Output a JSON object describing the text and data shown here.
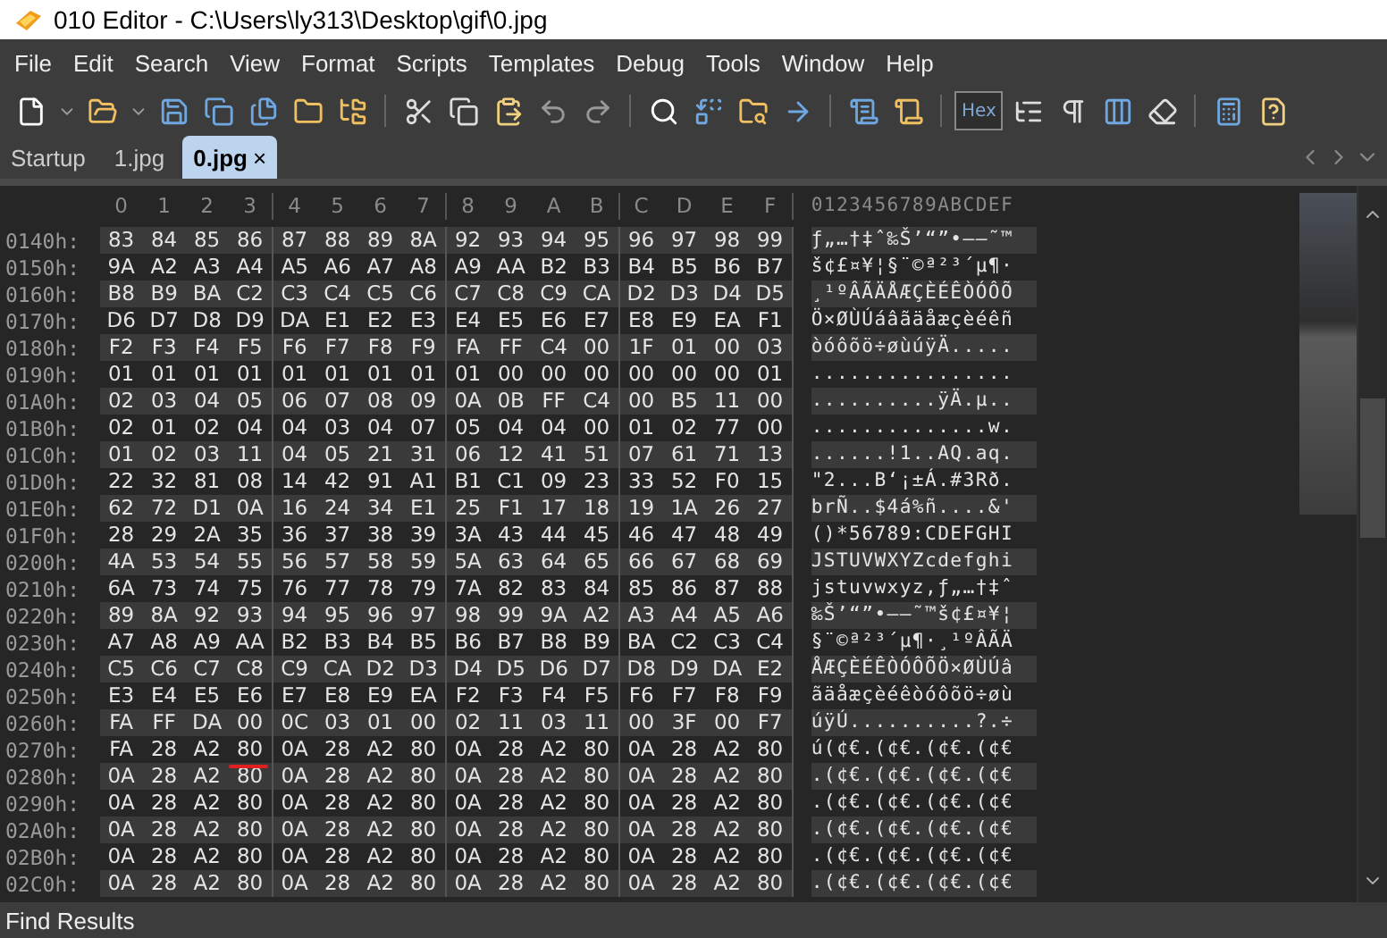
{
  "window": {
    "title": "010 Editor - C:\\Users\\ly313\\Desktop\\gif\\0.jpg"
  },
  "menu": [
    "File",
    "Edit",
    "Search",
    "View",
    "Format",
    "Scripts",
    "Templates",
    "Debug",
    "Tools",
    "Window",
    "Help"
  ],
  "toolbar": {
    "hex_toggle": {
      "label": "Hex",
      "selected": true
    }
  },
  "tabs": [
    {
      "label": "Startup",
      "selected": false
    },
    {
      "label": "1.jpg",
      "selected": false
    },
    {
      "label": "0.jpg",
      "selected": true,
      "close": "×"
    }
  ],
  "editor": {
    "columns": [
      "0",
      "1",
      "2",
      "3",
      "4",
      "5",
      "6",
      "7",
      "8",
      "9",
      "A",
      "B",
      "C",
      "D",
      "E",
      "F"
    ],
    "text_header": "0123456789ABCDEF",
    "rows": [
      {
        "address": "0140h:",
        "bytes": [
          "83",
          "84",
          "85",
          "86",
          "87",
          "88",
          "89",
          "8A",
          "92",
          "93",
          "94",
          "95",
          "96",
          "97",
          "98",
          "99"
        ],
        "text": "ƒ„…†‡ˆ‰Š’“”•–—˜™"
      },
      {
        "address": "0150h:",
        "bytes": [
          "9A",
          "A2",
          "A3",
          "A4",
          "A5",
          "A6",
          "A7",
          "A8",
          "A9",
          "AA",
          "B2",
          "B3",
          "B4",
          "B5",
          "B6",
          "B7"
        ],
        "text": "š¢£¤¥¦§¨©ª²³´µ¶·"
      },
      {
        "address": "0160h:",
        "bytes": [
          "B8",
          "B9",
          "BA",
          "C2",
          "C3",
          "C4",
          "C5",
          "C6",
          "C7",
          "C8",
          "C9",
          "CA",
          "D2",
          "D3",
          "D4",
          "D5"
        ],
        "text": "¸¹ºÂÃÄÅÆÇÈÉÊÒÓÔÕ"
      },
      {
        "address": "0170h:",
        "bytes": [
          "D6",
          "D7",
          "D8",
          "D9",
          "DA",
          "E1",
          "E2",
          "E3",
          "E4",
          "E5",
          "E6",
          "E7",
          "E8",
          "E9",
          "EA",
          "F1"
        ],
        "text": "Ö×ØÙÚáâãäåæçèéêñ"
      },
      {
        "address": "0180h:",
        "bytes": [
          "F2",
          "F3",
          "F4",
          "F5",
          "F6",
          "F7",
          "F8",
          "F9",
          "FA",
          "FF",
          "C4",
          "00",
          "1F",
          "01",
          "00",
          "03"
        ],
        "text": "òóôõö÷øùúÿÄ....."
      },
      {
        "address": "0190h:",
        "bytes": [
          "01",
          "01",
          "01",
          "01",
          "01",
          "01",
          "01",
          "01",
          "01",
          "00",
          "00",
          "00",
          "00",
          "00",
          "00",
          "01"
        ],
        "text": "................"
      },
      {
        "address": "01A0h:",
        "bytes": [
          "02",
          "03",
          "04",
          "05",
          "06",
          "07",
          "08",
          "09",
          "0A",
          "0B",
          "FF",
          "C4",
          "00",
          "B5",
          "11",
          "00"
        ],
        "text": "..........ÿÄ.µ.."
      },
      {
        "address": "01B0h:",
        "bytes": [
          "02",
          "01",
          "02",
          "04",
          "04",
          "03",
          "04",
          "07",
          "05",
          "04",
          "04",
          "00",
          "01",
          "02",
          "77",
          "00"
        ],
        "text": "..............w."
      },
      {
        "address": "01C0h:",
        "bytes": [
          "01",
          "02",
          "03",
          "11",
          "04",
          "05",
          "21",
          "31",
          "06",
          "12",
          "41",
          "51",
          "07",
          "61",
          "71",
          "13"
        ],
        "text": "......!1..AQ.aq."
      },
      {
        "address": "01D0h:",
        "bytes": [
          "22",
          "32",
          "81",
          "08",
          "14",
          "42",
          "91",
          "A1",
          "B1",
          "C1",
          "09",
          "23",
          "33",
          "52",
          "F0",
          "15"
        ],
        "text": "\"2...B‘¡±Á.#3Rð."
      },
      {
        "address": "01E0h:",
        "bytes": [
          "62",
          "72",
          "D1",
          "0A",
          "16",
          "24",
          "34",
          "E1",
          "25",
          "F1",
          "17",
          "18",
          "19",
          "1A",
          "26",
          "27"
        ],
        "text": "brÑ..$4á%ñ....&'"
      },
      {
        "address": "01F0h:",
        "bytes": [
          "28",
          "29",
          "2A",
          "35",
          "36",
          "37",
          "38",
          "39",
          "3A",
          "43",
          "44",
          "45",
          "46",
          "47",
          "48",
          "49"
        ],
        "text": "()*56789:CDEFGHI"
      },
      {
        "address": "0200h:",
        "bytes": [
          "4A",
          "53",
          "54",
          "55",
          "56",
          "57",
          "58",
          "59",
          "5A",
          "63",
          "64",
          "65",
          "66",
          "67",
          "68",
          "69"
        ],
        "text": "JSTUVWXYZcdefghi"
      },
      {
        "address": "0210h:",
        "bytes": [
          "6A",
          "73",
          "74",
          "75",
          "76",
          "77",
          "78",
          "79",
          "7A",
          "82",
          "83",
          "84",
          "85",
          "86",
          "87",
          "88"
        ],
        "text": "jstuvwxyz‚ƒ„…†‡ˆ"
      },
      {
        "address": "0220h:",
        "bytes": [
          "89",
          "8A",
          "92",
          "93",
          "94",
          "95",
          "96",
          "97",
          "98",
          "99",
          "9A",
          "A2",
          "A3",
          "A4",
          "A5",
          "A6"
        ],
        "text": "‰Š’“”•–—˜™š¢£¤¥¦"
      },
      {
        "address": "0230h:",
        "bytes": [
          "A7",
          "A8",
          "A9",
          "AA",
          "B2",
          "B3",
          "B4",
          "B5",
          "B6",
          "B7",
          "B8",
          "B9",
          "BA",
          "C2",
          "C3",
          "C4"
        ],
        "text": "§¨©ª²³´µ¶·¸¹ºÂÃÄ"
      },
      {
        "address": "0240h:",
        "bytes": [
          "C5",
          "C6",
          "C7",
          "C8",
          "C9",
          "CA",
          "D2",
          "D3",
          "D4",
          "D5",
          "D6",
          "D7",
          "D8",
          "D9",
          "DA",
          "E2"
        ],
        "text": "ÅÆÇÈÉÊÒÓÔÕÖ×ØÙÚâ"
      },
      {
        "address": "0250h:",
        "bytes": [
          "E3",
          "E4",
          "E5",
          "E6",
          "E7",
          "E8",
          "E9",
          "EA",
          "F2",
          "F3",
          "F4",
          "F5",
          "F6",
          "F7",
          "F8",
          "F9"
        ],
        "text": "ãäåæçèéêòóôõö÷øù"
      },
      {
        "address": "0260h:",
        "bytes": [
          "FA",
          "FF",
          "DA",
          "00",
          "0C",
          "03",
          "01",
          "00",
          "02",
          "11",
          "03",
          "11",
          "00",
          "3F",
          "00",
          "F7"
        ],
        "text": "úÿÚ..........?.÷"
      },
      {
        "address": "0270h:",
        "bytes": [
          "FA",
          "28",
          "A2",
          "80",
          "0A",
          "28",
          "A2",
          "80",
          "0A",
          "28",
          "A2",
          "80",
          "0A",
          "28",
          "A2",
          "80"
        ],
        "text": "ú(¢€.(¢€.(¢€.(¢€"
      },
      {
        "address": "0280h:",
        "bytes": [
          "0A",
          "28",
          "A2",
          "80",
          "0A",
          "28",
          "A2",
          "80",
          "0A",
          "28",
          "A2",
          "80",
          "0A",
          "28",
          "A2",
          "80"
        ],
        "text": ".(¢€.(¢€.(¢€.(¢€"
      },
      {
        "address": "0290h:",
        "bytes": [
          "0A",
          "28",
          "A2",
          "80",
          "0A",
          "28",
          "A2",
          "80",
          "0A",
          "28",
          "A2",
          "80",
          "0A",
          "28",
          "A2",
          "80"
        ],
        "text": ".(¢€.(¢€.(¢€.(¢€"
      },
      {
        "address": "02A0h:",
        "bytes": [
          "0A",
          "28",
          "A2",
          "80",
          "0A",
          "28",
          "A2",
          "80",
          "0A",
          "28",
          "A2",
          "80",
          "0A",
          "28",
          "A2",
          "80"
        ],
        "text": ".(¢€.(¢€.(¢€.(¢€"
      },
      {
        "address": "02B0h:",
        "bytes": [
          "0A",
          "28",
          "A2",
          "80",
          "0A",
          "28",
          "A2",
          "80",
          "0A",
          "28",
          "A2",
          "80",
          "0A",
          "28",
          "A2",
          "80"
        ],
        "text": ".(¢€.(¢€.(¢€.(¢€"
      },
      {
        "address": "02C0h:",
        "bytes": [
          "0A",
          "28",
          "A2",
          "80",
          "0A",
          "28",
          "A2",
          "80",
          "0A",
          "28",
          "A2",
          "80",
          "0A",
          "28",
          "A2",
          "80"
        ],
        "text": ".(¢€.(¢€.(¢€.(¢€"
      }
    ]
  },
  "bottom_panel": {
    "title": "Find Results"
  }
}
